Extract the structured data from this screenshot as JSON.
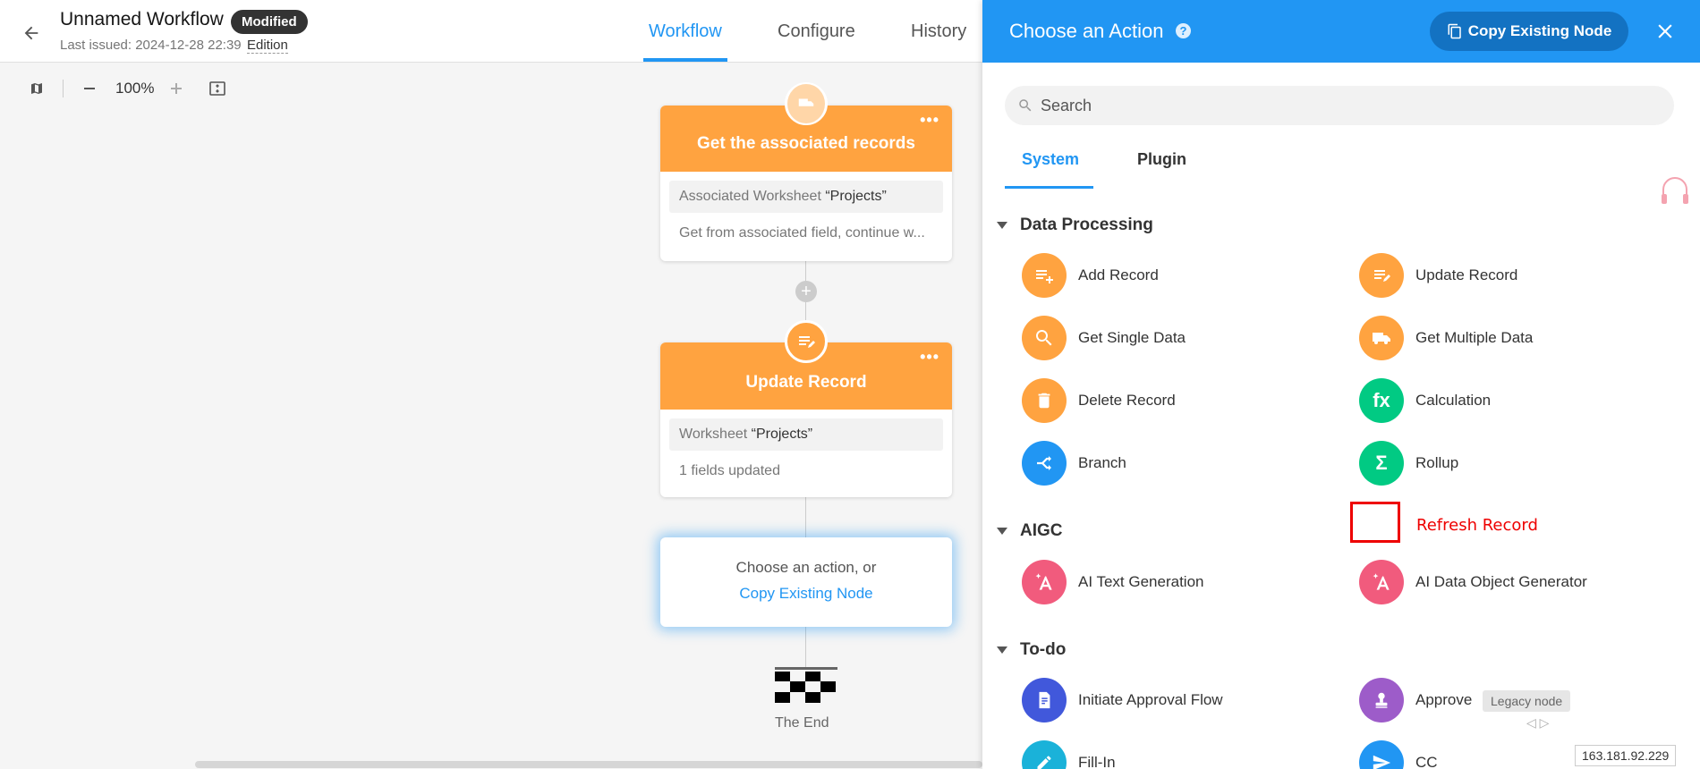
{
  "header": {
    "title": "Unnamed Workflow",
    "badge": "Modified",
    "last_issued": "Last issued: 2024-12-28 22:39",
    "edition": "Edition",
    "tabs": [
      "Workflow",
      "Configure",
      "History"
    ]
  },
  "toolbar": {
    "zoom": "100%"
  },
  "nodes": {
    "get_records": {
      "title": "Get the associated records",
      "row_label": "Associated Worksheet",
      "row_value": "“Projects”",
      "sub": "Get from associated field, continue w..."
    },
    "update_record": {
      "title": "Update Record",
      "row_label": "Worksheet",
      "row_value": "“Projects”",
      "sub": "1 fields updated"
    },
    "choose": {
      "line1": "Choose an action, or",
      "line2": "Copy Existing Node"
    },
    "end": "The End"
  },
  "panel": {
    "title": "Choose an Action",
    "copy_button": "Copy Existing Node",
    "search_placeholder": "Search",
    "tabs": [
      "System",
      "Plugin"
    ],
    "sections": {
      "data_processing": "Data Processing",
      "aigc": "AIGC",
      "todo": "To-do"
    },
    "items": {
      "add_record": "Add Record",
      "update_record": "Update Record",
      "get_single": "Get Single Data",
      "get_multiple": "Get Multiple Data",
      "delete_record": "Delete Record",
      "calculation": "Calculation",
      "branch": "Branch",
      "rollup": "Rollup",
      "ai_text": "AI Text Generation",
      "ai_object": "AI Data Object Generator",
      "approval_flow": "Initiate Approval Flow",
      "approve": "Approve",
      "fill_in": "Fill-In",
      "cc": "CC"
    },
    "icon_text": {
      "calculation": "fx",
      "rollup": "Σ"
    },
    "refresh_annotation": "Refresh Record",
    "legacy_tooltip": "Legacy node"
  },
  "ip_address": "163.181.92.229",
  "colors": {
    "accent": "#2196f3",
    "orange": "#ffa340",
    "green": "#01ca83",
    "pink": "#f15b7d"
  }
}
